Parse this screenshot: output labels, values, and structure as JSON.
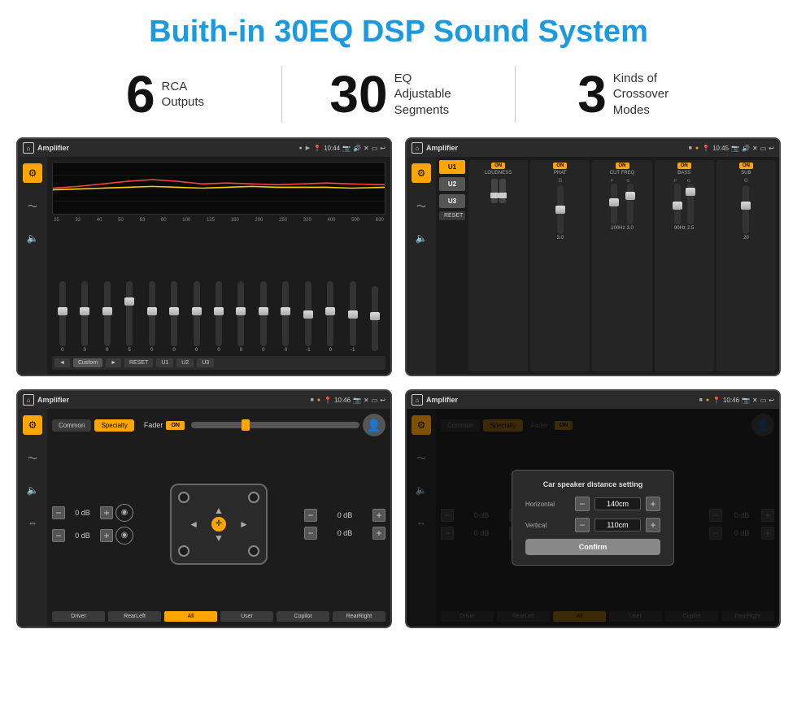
{
  "page": {
    "title": "Buith-in 30EQ DSP Sound System",
    "stats": [
      {
        "number": "6",
        "text_line1": "RCA",
        "text_line2": "Outputs"
      },
      {
        "number": "30",
        "text_line1": "EQ Adjustable",
        "text_line2": "Segments"
      },
      {
        "number": "3",
        "text_line1": "Kinds of",
        "text_line2": "Crossover Modes"
      }
    ]
  },
  "screens": {
    "screen1": {
      "title": "Amplifier",
      "time": "10:44",
      "eq_freqs": [
        "25",
        "32",
        "40",
        "50",
        "63",
        "80",
        "100",
        "125",
        "160",
        "200",
        "250",
        "320",
        "400",
        "500",
        "630"
      ],
      "eq_values": [
        "0",
        "0",
        "0",
        "5",
        "0",
        "0",
        "0",
        "0",
        "0",
        "0",
        "0",
        "-1",
        "0",
        "-1",
        ""
      ],
      "controls": [
        "◄",
        "Custom",
        "►",
        "RESET",
        "U1",
        "U2",
        "U3"
      ]
    },
    "screen2": {
      "title": "Amplifier",
      "time": "10:45",
      "presets": [
        "U1",
        "U2",
        "U3"
      ],
      "controls": [
        "LOUDNESS",
        "PHAT",
        "CUT FREQ",
        "BASS",
        "SUB"
      ],
      "reset_label": "RESET"
    },
    "screen3": {
      "title": "Amplifier",
      "time": "10:46",
      "tabs": [
        "Common",
        "Specialty"
      ],
      "fader_label": "Fader",
      "fader_on": "ON",
      "db_values": [
        "0 dB",
        "0 dB",
        "0 dB",
        "0 dB"
      ],
      "bottom_btns": [
        "Driver",
        "RearLeft",
        "All",
        "User",
        "Copilot",
        "RearRight"
      ]
    },
    "screen4": {
      "title": "Amplifier",
      "time": "10:46",
      "tabs": [
        "Common",
        "Specialty"
      ],
      "dialog": {
        "title": "Car speaker distance setting",
        "horizontal_label": "Horizontal",
        "horizontal_value": "140cm",
        "vertical_label": "Vertical",
        "vertical_value": "110cm",
        "confirm_label": "Confirm"
      },
      "bottom_btns": [
        "Driver",
        "RearLeft",
        "All",
        "User",
        "Copilot",
        "RearRight"
      ]
    }
  },
  "icons": {
    "home": "⌂",
    "play": "▶",
    "back": "↩",
    "pin": "📍",
    "camera": "📷",
    "volume": "🔊",
    "x": "✕",
    "minus": "−",
    "plus": "+",
    "eq_icon": "🎛",
    "wave": "〰",
    "speaker": "🔈"
  }
}
